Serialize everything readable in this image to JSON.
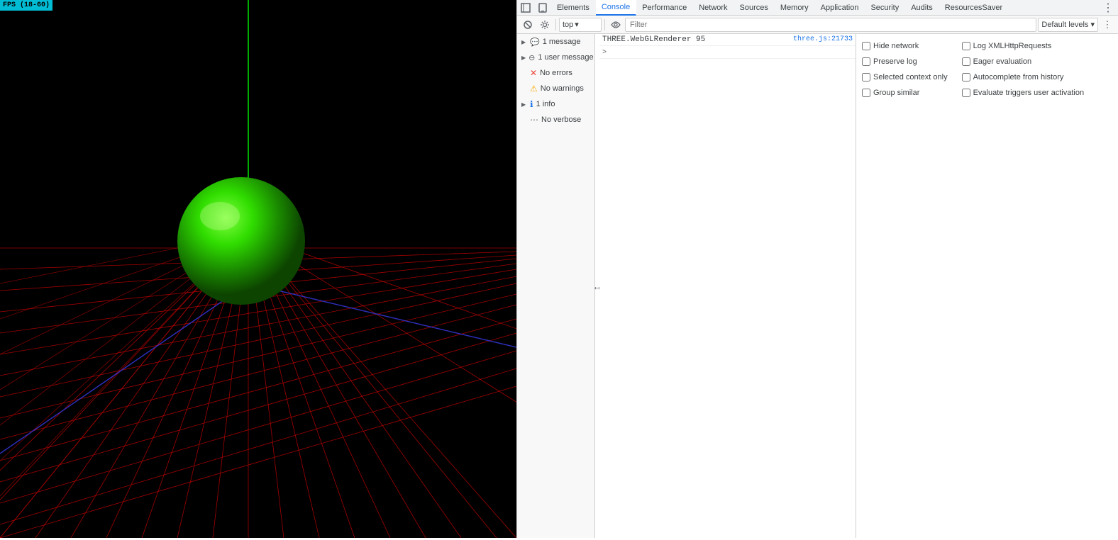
{
  "canvas": {
    "fps_label": "FPS (18-60)"
  },
  "devtools": {
    "tabs": [
      {
        "label": "Elements",
        "active": false
      },
      {
        "label": "Console",
        "active": true
      },
      {
        "label": "Performance",
        "active": false
      },
      {
        "label": "Network",
        "active": false
      },
      {
        "label": "Sources",
        "active": false
      },
      {
        "label": "Memory",
        "active": false
      },
      {
        "label": "Application",
        "active": false
      },
      {
        "label": "Security",
        "active": false
      },
      {
        "label": "Audits",
        "active": false
      },
      {
        "label": "ResourcesSaver",
        "active": false
      }
    ]
  },
  "console_toolbar": {
    "context_value": "top",
    "filter_placeholder": "Filter",
    "levels_label": "Default levels ▾",
    "eye_icon": "👁"
  },
  "console_sidebar": {
    "items": [
      {
        "icon": "💬",
        "icon_class": "icon-message",
        "label": "1 message",
        "has_arrow": true,
        "selected": false
      },
      {
        "icon": "⊖",
        "icon_class": "icon-user",
        "label": "1 user message",
        "has_arrow": true,
        "selected": false
      },
      {
        "icon": "🔴",
        "icon_class": "icon-error",
        "label": "No errors",
        "has_arrow": false,
        "selected": false
      },
      {
        "icon": "⚠",
        "icon_class": "icon-warning",
        "label": "No warnings",
        "has_arrow": false,
        "selected": false
      },
      {
        "icon": "ℹ",
        "icon_class": "icon-info",
        "label": "1 info",
        "has_arrow": true,
        "selected": false
      },
      {
        "icon": "⋯",
        "icon_class": "icon-verbose",
        "label": "No verbose",
        "has_arrow": false,
        "selected": false
      }
    ]
  },
  "console_settings_left": {
    "items": [
      {
        "label": "Hide network",
        "checked": false
      },
      {
        "label": "Preserve log",
        "checked": false
      },
      {
        "label": "Selected context only",
        "checked": false
      },
      {
        "label": "Group similar",
        "checked": false
      }
    ]
  },
  "console_settings_right": {
    "items": [
      {
        "label": "Log XMLHttpRequests",
        "checked": false
      },
      {
        "label": "Eager evaluation",
        "checked": false
      },
      {
        "label": "Autocomplete from history",
        "checked": false
      },
      {
        "label": "Evaluate triggers user activation",
        "checked": false
      }
    ]
  },
  "console_output": {
    "entries": [
      {
        "text": "THREE.WebGLRenderer  95",
        "source": "three.js:21733",
        "has_arrow": false
      }
    ],
    "prompt_arrow": ">"
  }
}
